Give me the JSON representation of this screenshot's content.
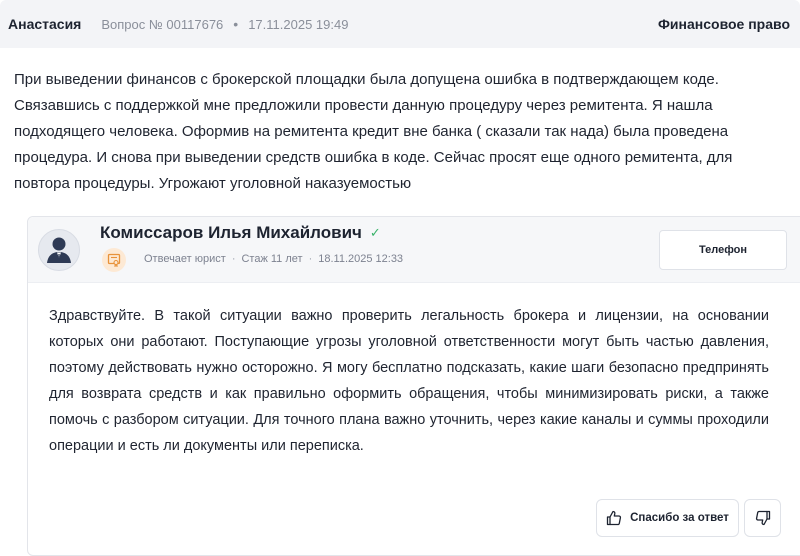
{
  "question": {
    "author": "Анастасия",
    "number_label": "Вопрос № 00117676",
    "separator": "•",
    "datetime": "17.11.2025 19:49",
    "category": "Финансовое право",
    "text": "При выведении финансов с брокерской площадки была допущена ошибка в подтверждающем коде. Связавшись с поддержкой мне предложили провести данную процедуру через ремитента. Я нашла подходящего человека. Оформив на ремитента кредит вне банка ( сказали так нада) была проведена процедура. И снова при выведении средств ошибка в коде. Сейчас просят еще одного ремитента, для повтора процедуры. Угрожают уголовной наказуемостью"
  },
  "answer": {
    "lawyer_name": "Комиссаров Илья Михайлович",
    "verified_icon": "check-icon",
    "role": "Отвечает юрист",
    "experience": "Стаж 11 лет",
    "datetime": "18.11.2025 12:33",
    "separator": "·",
    "phone_label": "Телефон",
    "text": "Здравствуйте. В такой ситуации важно проверить легальность брокера и лицензии, на основании которых они работают. Поступающие угрозы уголовной ответственности могут быть частью давления, поэтому действовать нужно осторожно. Я могу бесплатно подсказать, какие шаги безопасно предпринять для возврата средств и как правильно оформить обращения, чтобы минимизировать риски, а также помочь с разбором ситуации. Для точного плана важно уточнить, через какие каналы и суммы проходили операции и есть ли документы или переписка.",
    "thanks_label": "Спасибо за ответ"
  },
  "colors": {
    "header_bg": "#f3f4f7",
    "verified": "#3bb36b",
    "badge_bg": "#fde9d4",
    "badge_fg": "#e8923a",
    "muted_text": "#8a8f9a"
  }
}
